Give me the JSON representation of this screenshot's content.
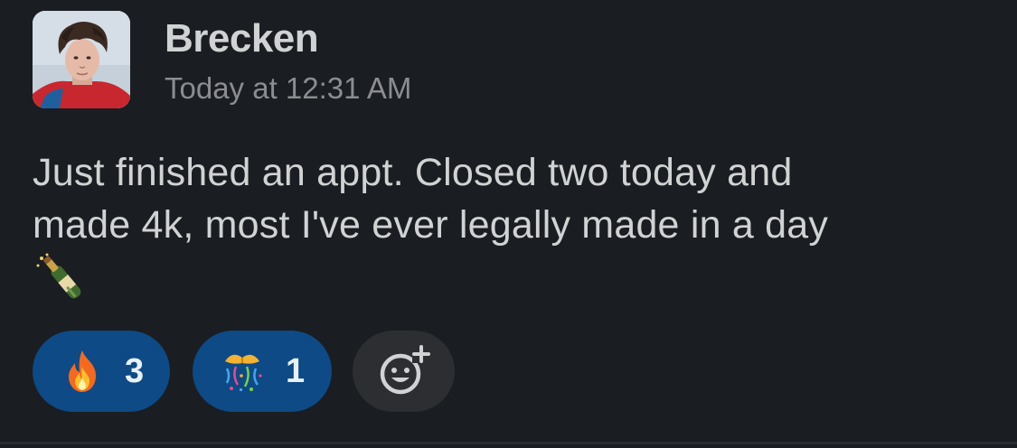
{
  "message": {
    "author": "Brecken",
    "timestamp": "Today at 12:31 AM",
    "text_lines": [
      "Just finished an appt. Closed two today and",
      "made 4k, most I've ever legally made in a day"
    ],
    "trailing_emoji": "bottle-with-popping-cork-icon"
  },
  "reactions": [
    {
      "emoji": "fire-icon",
      "count": "3"
    },
    {
      "emoji": "confetti-ball-icon",
      "count": "1"
    }
  ],
  "add_reaction": {
    "icon": "add-reaction-icon"
  },
  "colors": {
    "background": "#1a1d21",
    "text": "#d1d2d3",
    "muted": "#8b8d90",
    "reaction_active": "#0d4a86",
    "reaction_neutral": "#2c2e32"
  }
}
